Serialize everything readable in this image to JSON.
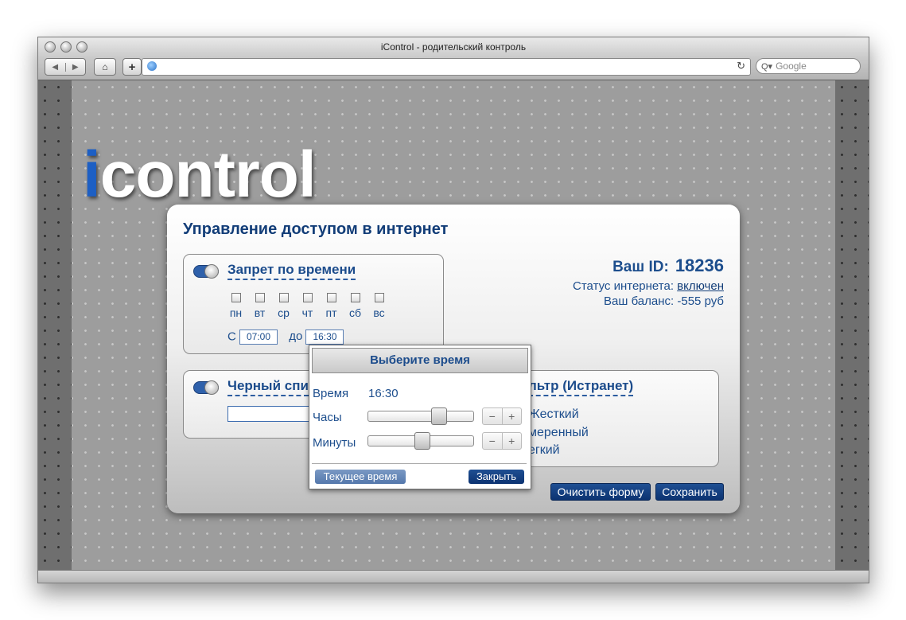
{
  "browser": {
    "title": "iControl - родительский контроль",
    "search_placeholder": "Google",
    "back_icon": "◀",
    "forward_icon": "▶",
    "home_icon": "⌂",
    "plus_label": "+",
    "reload_icon": "↻",
    "search_icon": "Q▾"
  },
  "logo": {
    "first": "i",
    "rest": "control",
    "accent": "#1d5fc4"
  },
  "panel": {
    "title": "Управление доступом в интернет",
    "time_ban": {
      "title": "Запрет по времени",
      "enabled": true,
      "days": [
        "пн",
        "вт",
        "ср",
        "чт",
        "пт",
        "сб",
        "вс"
      ],
      "from_label": "С",
      "from": "07:00",
      "to_label": "до",
      "to": "16:30"
    },
    "blacklist": {
      "title": "Черный спи",
      "enabled": true
    },
    "filter": {
      "title": "льтр (Истранет)",
      "options": [
        "Жесткий",
        "меренный",
        "егкий"
      ]
    },
    "account": {
      "id_label": "Ваш ID:",
      "id": "18236",
      "status_label": "Статус интернета:",
      "status": "включен",
      "balance_label": "Ваш баланс:",
      "balance": "-555 руб"
    },
    "clear_button": "Очистить форму",
    "save_button": "Сохранить"
  },
  "picker": {
    "title": "Выберите время",
    "time_label": "Время",
    "time_value": "16:30",
    "hours_label": "Часы",
    "hours": 16,
    "minutes_label": "Минуты",
    "minutes": 30,
    "minus": "−",
    "plus": "+",
    "now_button": "Текущее время",
    "close_button": "Закрыть"
  }
}
